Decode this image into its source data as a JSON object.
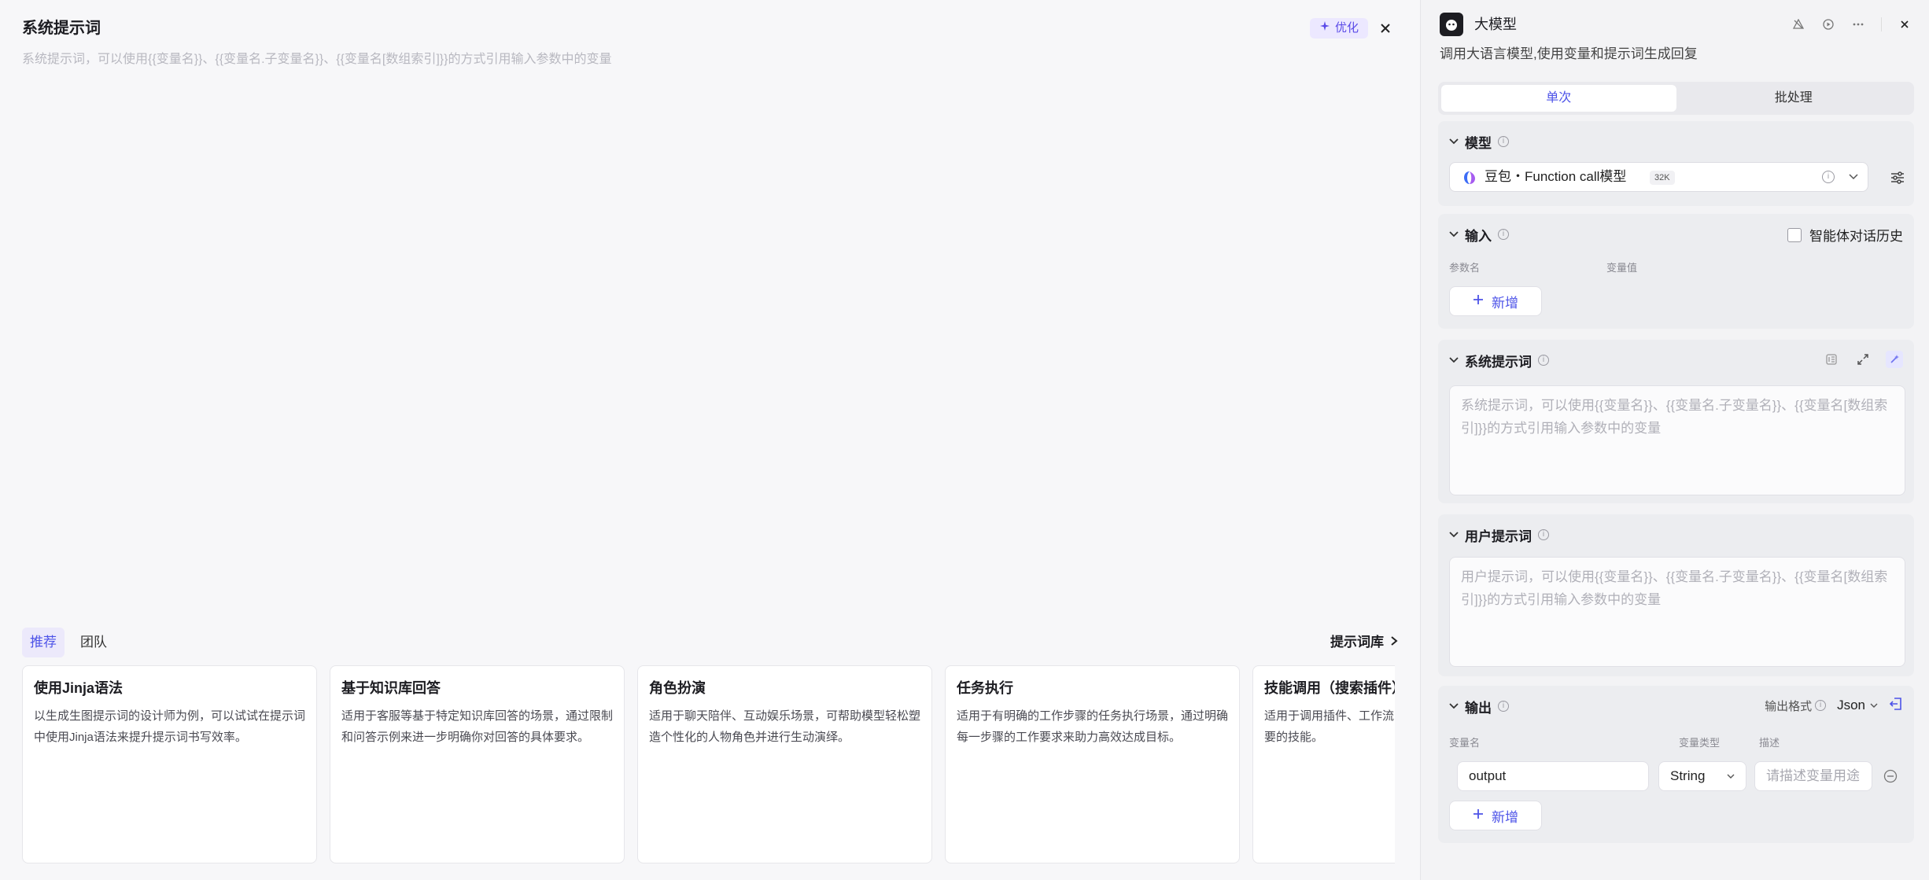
{
  "left": {
    "title": "系统提示词",
    "optimize_label": "优化",
    "placeholder": "系统提示词，可以使用{{变量名}}、{{变量名.子变量名}}、{{变量名[数组索引]}}的方式引用输入参数中的变量",
    "tabs": [
      {
        "label": "推荐"
      },
      {
        "label": "团队"
      }
    ],
    "library_link": "提示词库",
    "cards": [
      {
        "title": "使用Jinja语法",
        "desc": "以生成生图提示词的设计师为例，可以试试在提示词中使用Jinja语法来提升提示词书写效率。"
      },
      {
        "title": "基于知识库回答",
        "desc": "适用于客服等基于特定知识库回答的场景，通过限制和问答示例来进一步明确你对回答的具体要求。"
      },
      {
        "title": "角色扮演",
        "desc": "适用于聊天陪伴、互动娱乐场景，可帮助模型轻松塑造个性化的人物角色并进行生动演绎。"
      },
      {
        "title": "任务执行",
        "desc": "适用于有明确的工作步骤的任务执行场景，通过明确每一步骤的工作要求来助力高效达成目标。"
      },
      {
        "title": "技能调用（搜索插件）",
        "desc": "适用于调用插件、工作流的场景，使用时将提示词需要的技能。"
      }
    ]
  },
  "right": {
    "title": "大模型",
    "description": "调用大语言模型,使用变量和提示词生成回复",
    "segments": [
      {
        "label": "单次"
      },
      {
        "label": "批处理"
      }
    ],
    "model": {
      "section_title": "模型",
      "name": "豆包・Function call模型",
      "badge": "32K"
    },
    "input": {
      "section_title": "输入",
      "history_label": "智能体对话历史",
      "col_param": "参数名",
      "col_value": "变量值",
      "add_label": "新增"
    },
    "system_prompt": {
      "section_title": "系统提示词",
      "placeholder": "系统提示词，可以使用{{变量名}}、{{变量名.子变量名}}、{{变量名[数组索引]}}的方式引用输入参数中的变量"
    },
    "user_prompt": {
      "section_title": "用户提示词",
      "placeholder": "用户提示词，可以使用{{变量名}}、{{变量名.子变量名}}、{{变量名[数组索引]}}的方式引用输入参数中的变量"
    },
    "output": {
      "section_title": "输出",
      "format_label": "输出格式",
      "format_value": "Json",
      "col_name": "变量名",
      "col_type": "变量类型",
      "col_desc": "描述",
      "var_name": "output",
      "var_type": "String",
      "desc_placeholder": "请描述变量用途",
      "add_label": "新增"
    }
  }
}
